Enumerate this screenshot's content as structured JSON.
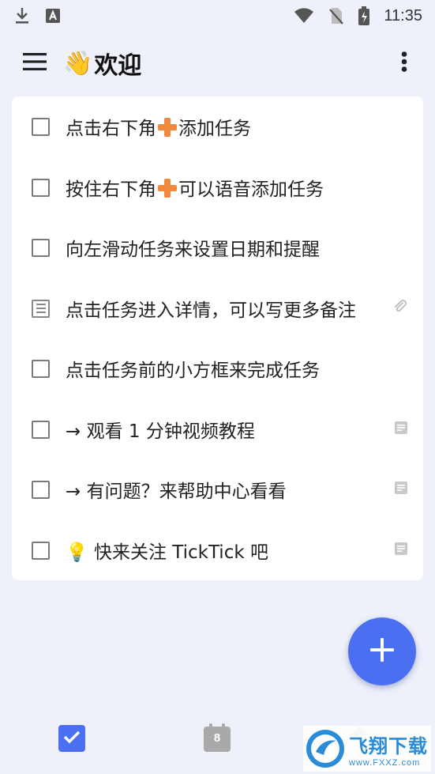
{
  "status_bar": {
    "time": "11:35"
  },
  "header": {
    "title_emoji": "👋",
    "title": "欢迎"
  },
  "tasks": [
    {
      "kind": "checkbox",
      "parts": [
        "点击右下角",
        "添加任务"
      ],
      "has_plus": true
    },
    {
      "kind": "checkbox",
      "parts": [
        "按住右下角",
        "可以语音添加任务"
      ],
      "has_plus": true
    },
    {
      "kind": "checkbox",
      "text": "向左滑动任务来设置日期和提醒"
    },
    {
      "kind": "note",
      "text": "点击任务进入详情，可以写更多备注",
      "right_icon": "attachment-icon"
    },
    {
      "kind": "checkbox",
      "text": "点击任务前的小方框来完成任务"
    },
    {
      "kind": "checkbox",
      "text": "→ 观看 1 分钟视频教程",
      "right_icon": "note-icon"
    },
    {
      "kind": "checkbox",
      "text": "→ 有问题？来帮助中心看看",
      "right_icon": "note-icon"
    },
    {
      "kind": "checkbox",
      "emoji": "💡",
      "text": "快来关注 TickTick 吧",
      "right_icon": "note-icon"
    }
  ],
  "bottom_nav": {
    "calendar_date": "8"
  },
  "watermark": {
    "main": "飞翔下载",
    "sub": "www.FXXZ.com"
  },
  "colors": {
    "accent": "#4a6ff0",
    "background": "#eef0fa"
  }
}
